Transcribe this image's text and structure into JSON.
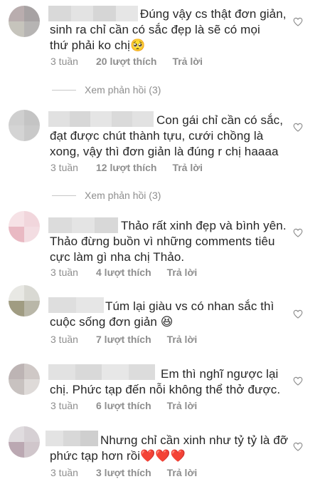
{
  "comments": [
    {
      "avatar_colors": [
        "#b9adae",
        "#a7a2a3",
        "#c6c4bc",
        "#b6b4b3"
      ],
      "name_colors": [
        "#d9d9d9",
        "#e3e3e3",
        "#d6d6d6",
        "#e6e6e6"
      ],
      "lines": [
        "Đúng vậy cs thật đơn giản,",
        "sinh ra chỉ cần có sắc đẹp là sẽ có mọi",
        "thứ phải ko chị🥺"
      ],
      "time": "3 tuần",
      "likes": "20 lượt thích",
      "reply": "Trả lời"
    },
    {
      "avatar_colors": [
        "#cfcfcf",
        "#c4c4c4",
        "#d4d4d4",
        "#c9c9c9"
      ],
      "name_colors": [
        "#e1e1e1",
        "#d7d7d7",
        "#e5e5e5",
        "#dadada",
        "#e2e2e2"
      ],
      "lines": [
        "Con gái chỉ cần có sắc,",
        "đạt được chút thành tựu, cưới chồng là",
        "xong, vậy thì đơn giản là đúng r chị haaaa"
      ],
      "time": "3 tuần",
      "likes": "12 lượt thích",
      "reply": "Trả lời"
    },
    {
      "avatar_colors": [
        "#f6e2e6",
        "#f1d6dc",
        "#e9b9c3",
        "#f3dde2"
      ],
      "name_colors": [
        "#dcdcdc",
        "#e4e4e4",
        "#d8d8d8"
      ],
      "lines": [
        "Thảo rất xinh đẹp và bình yên.",
        "Thảo đừng buồn vì những comments tiêu",
        "cực làm gì nha chị Thảo."
      ],
      "time": "3 tuần",
      "likes": "4 lượt thích",
      "reply": "Trả lời"
    },
    {
      "avatar_colors": [
        "#e8e8e4",
        "#d9d9d3",
        "#a09c82",
        "#b9b7a8"
      ],
      "name_colors": [
        "#dedede",
        "#e6e6e6"
      ],
      "lines": [
        "Túm lại giàu vs có nhan sắc thì",
        "cuộc sống đơn giản 😆"
      ],
      "time": "3 tuần",
      "likes": "7 lượt thích",
      "reply": "Trả lời"
    },
    {
      "avatar_colors": [
        "#bdb4b4",
        "#cfc8c6",
        "#c8c2c0",
        "#dedad8"
      ],
      "name_colors": [
        "#e2e2e2",
        "#d9d9d9",
        "#e7e7e7",
        "#dcdcdc"
      ],
      "lines": [
        "Em thì nghĩ ngược lại",
        "chị. Phức tạp đến nỗi không thể thở được."
      ],
      "time": "3 tuần",
      "likes": "6 lượt thích",
      "reply": "Trả lời"
    },
    {
      "avatar_colors": [
        "#e0dcdf",
        "#d6d0d4",
        "#bba8b2",
        "#d0c6cb"
      ],
      "name_colors": [
        "#e3e3e3",
        "#d8d8d8",
        "#cfcfcf"
      ],
      "lines": [
        "Nhưng chỉ cần xinh như tỷ tỷ là đỡ",
        "phức tạp hơn rồi❤️❤️❤️"
      ],
      "time": "3 tuần",
      "likes": "3 lượt thích",
      "reply": "Trả lời"
    }
  ],
  "view_replies": [
    {
      "label": "Xem phản hồi (3)"
    },
    {
      "label": "Xem phản hồi (3)"
    }
  ]
}
